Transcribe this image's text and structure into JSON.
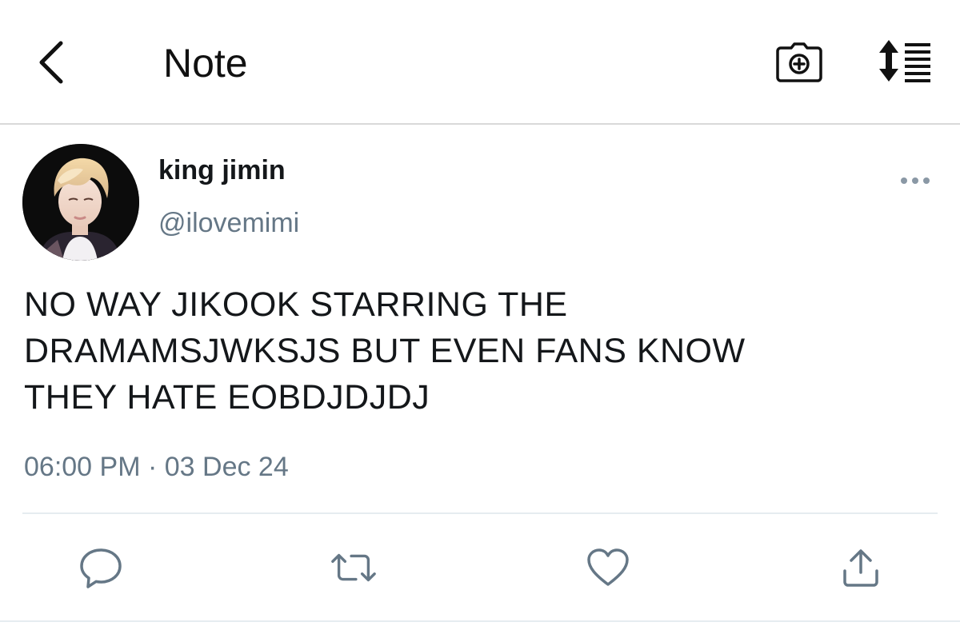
{
  "header": {
    "title": "Note",
    "back_icon": "chevron-left-icon",
    "camera_icon": "camera-add-icon",
    "sort_icon": "sort-list-icon"
  },
  "tweet": {
    "display_name": "king jimin",
    "handle": "@ilovemimi",
    "text": "NO WAY JIKOOK STARRING THE\nDRAMAMSJWKSJS BUT EVEN FANS KNOW\nTHEY HATE EOBDJDJDJ",
    "timestamp": "06:00 PM · 03 Dec 24",
    "more_icon": "more-options-icon"
  },
  "actions": {
    "reply_icon": "reply-icon",
    "retweet_icon": "retweet-icon",
    "like_icon": "heart-icon",
    "share_icon": "share-icon"
  },
  "colors": {
    "text_primary": "#14171a",
    "text_secondary": "#657786",
    "divider": "#e6ecf0",
    "icon": "#657786"
  }
}
